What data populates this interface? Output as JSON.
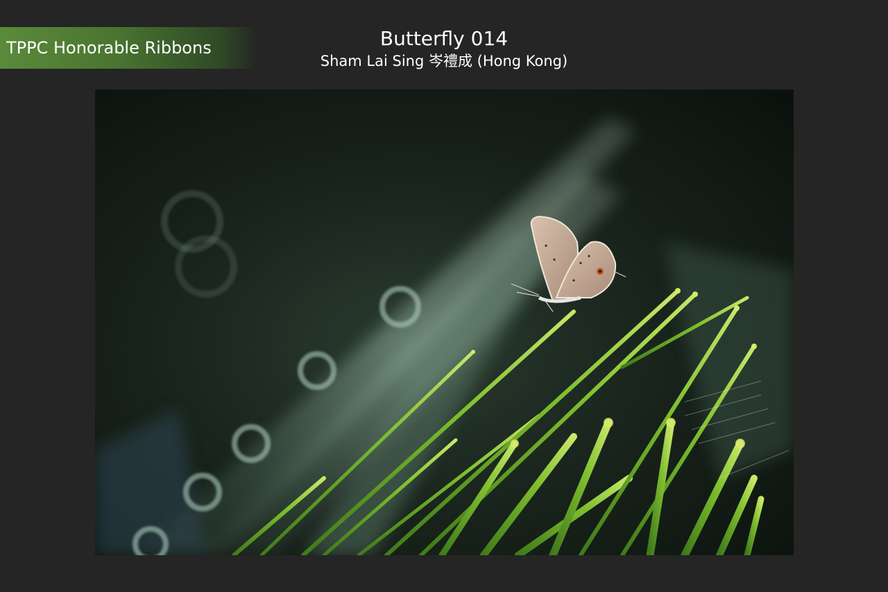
{
  "ribbon": {
    "label": "TPPC Honorable Ribbons",
    "color": "#5a8a3a"
  },
  "header": {
    "title": "Butterfly 014",
    "subtitle": "Sham Lai Sing 岑禮成 (Hong Kong)"
  },
  "photo": {
    "subject": "butterfly-on-grass",
    "background_color": "#0f1712",
    "accent_green": "#7fbf2e"
  }
}
